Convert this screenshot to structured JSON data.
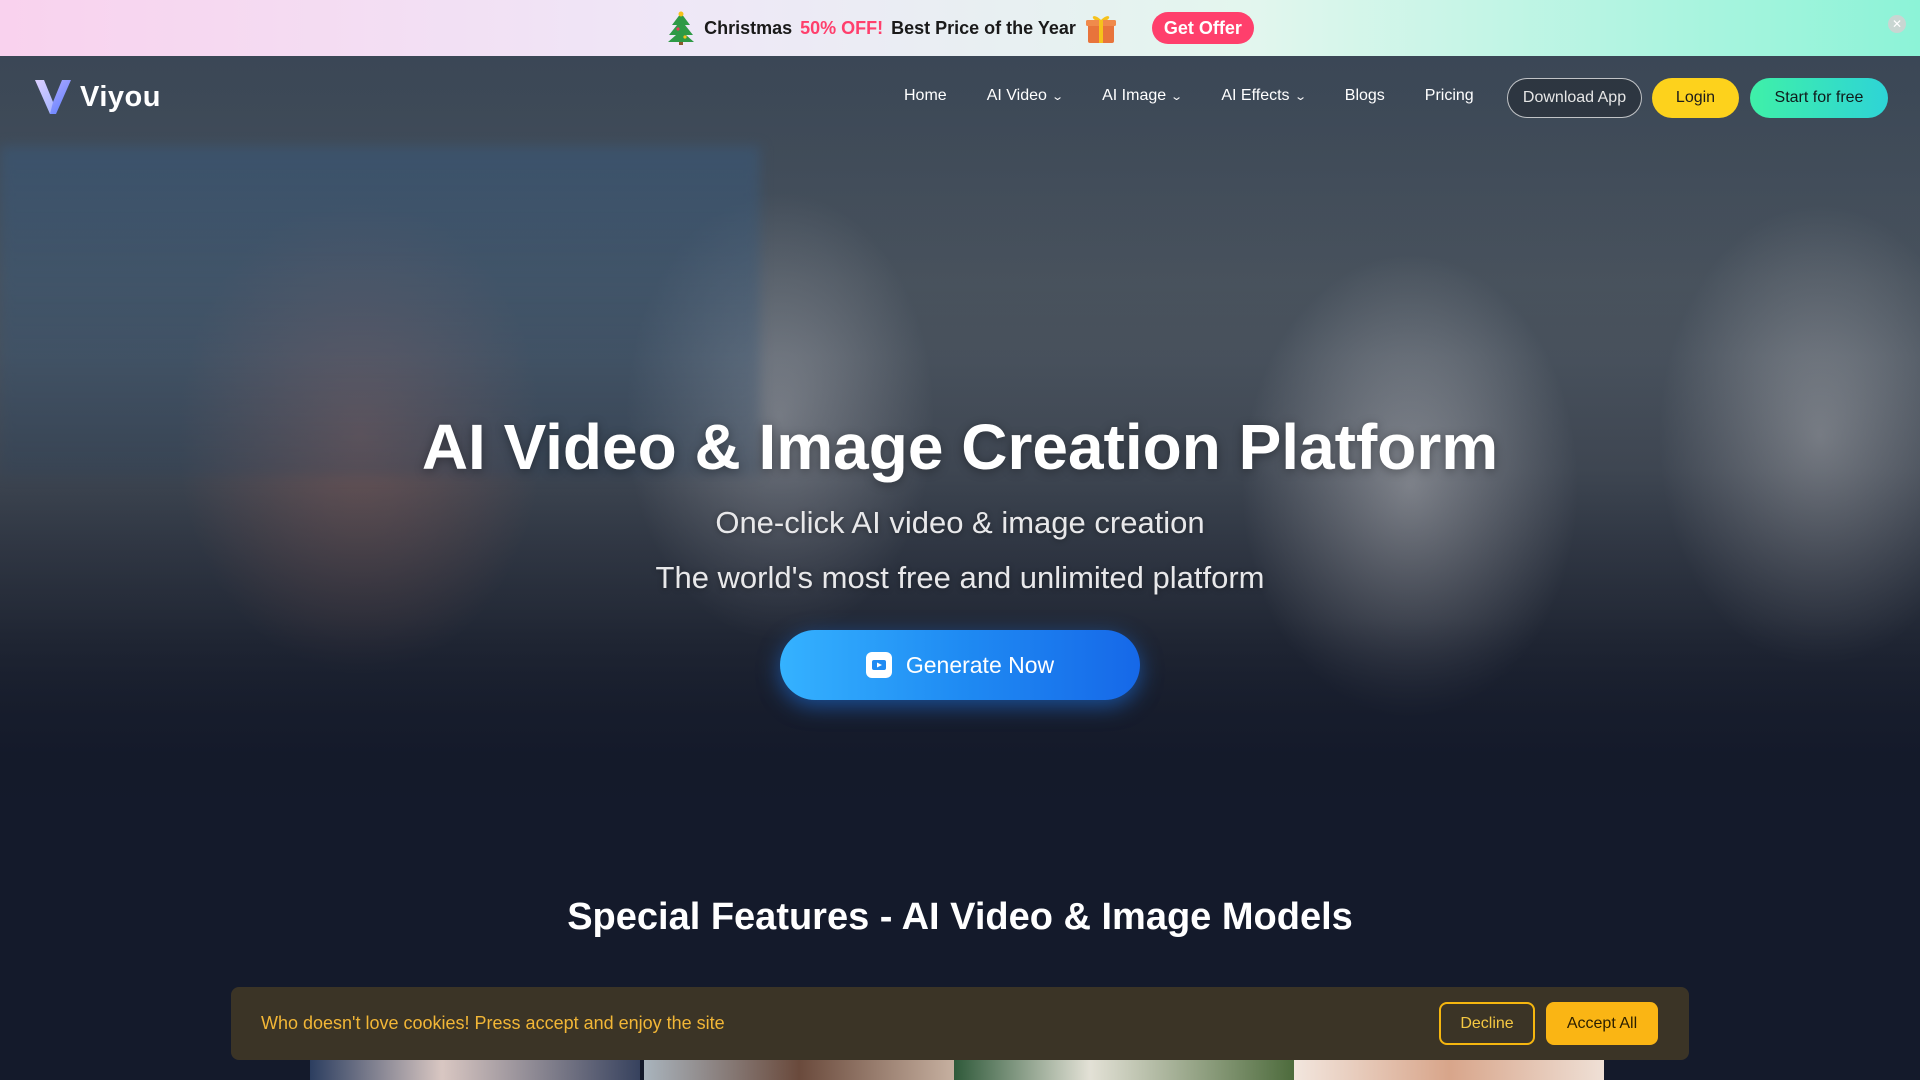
{
  "promo": {
    "lead": "Christmas",
    "discount": "50% OFF!",
    "tail": "Best Price of the Year",
    "button": "Get Offer",
    "close_icon": "close-icon",
    "tree_icon": "christmas-tree-icon",
    "gift_icon": "gift-icon",
    "accent": "#ff3f6c"
  },
  "nav": {
    "brand": "Viyou",
    "links": [
      "Home",
      "AI Video",
      "AI Image",
      "AI Effects",
      "Blogs",
      "Pricing"
    ],
    "download": "Download App",
    "login": "Login",
    "start": "Start for free"
  },
  "hero": {
    "title": "AI Video & Image Creation Platform",
    "subtitle1": "One-click AI video & image creation",
    "subtitle2": "The world's most free and unlimited platform",
    "cta": "Generate Now"
  },
  "features": {
    "title": "Special Features - AI Video & Image Models"
  },
  "cookie": {
    "text": "Who doesn't love cookies! Press accept and enjoy the site",
    "decline": "Decline",
    "accept": "Accept All"
  },
  "colors": {
    "login": "#fdd21c",
    "start_gradient": [
      "#3ff0a8",
      "#2ed4d6"
    ],
    "generate_gradient": [
      "#35b2ff",
      "#1668e8"
    ],
    "cookie_accent": "#f5b60f",
    "page_bg": "#141a2b"
  }
}
